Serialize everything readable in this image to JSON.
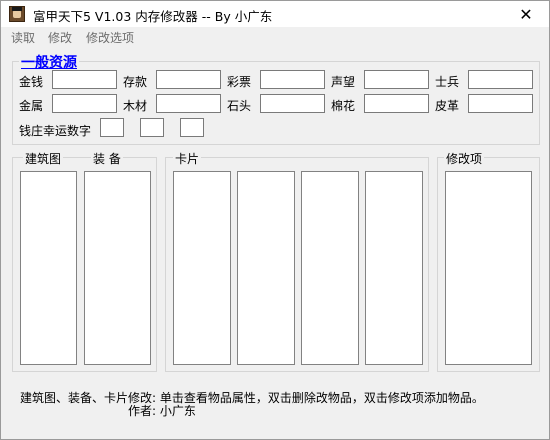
{
  "window": {
    "title": "富甲天下5 V1.03 内存修改器  --  By 小广东",
    "close_glyph": "✕"
  },
  "menu": {
    "items": [
      "读取",
      "修改",
      "修改选项"
    ]
  },
  "resources": {
    "title": "一般资源",
    "fields": [
      "金钱",
      "存款",
      "彩票",
      "声望",
      "士兵",
      "金属",
      "木材",
      "石头",
      "棉花",
      "皮革"
    ],
    "lucky_label": "钱庄幸运数字"
  },
  "groups": {
    "building_label": "建筑图",
    "equip_label": "装 备",
    "cards_label": "卡片",
    "modify_label": "修改项"
  },
  "footer": {
    "help": "建筑图、装备、卡片修改: 单击查看物品属性，双击删除改物品，双击修改项添加物品。",
    "author": "作者: 小广东"
  }
}
